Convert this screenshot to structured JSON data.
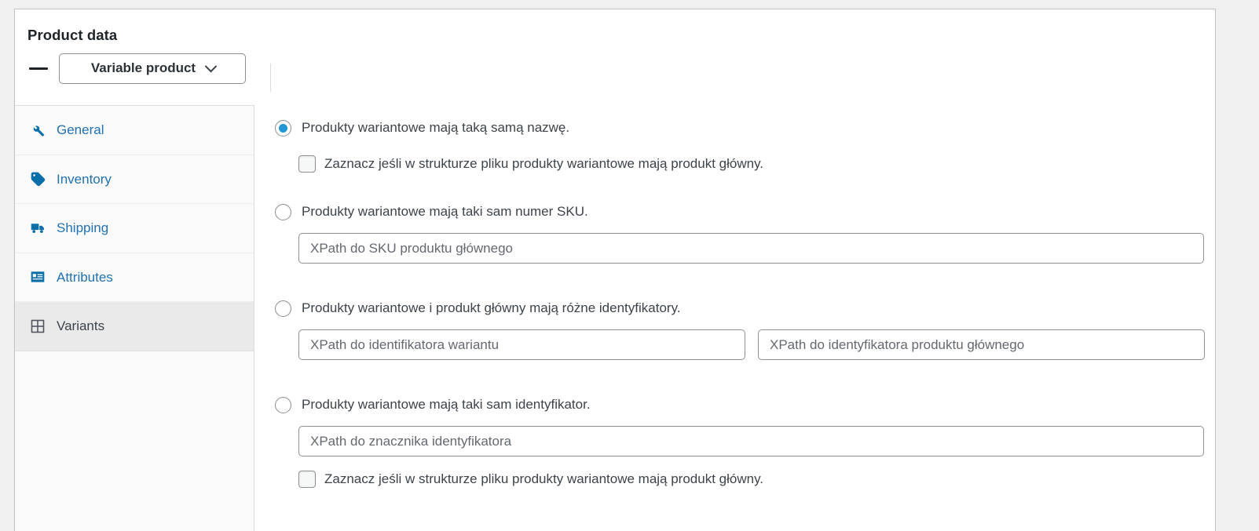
{
  "panel": {
    "title": "Product data",
    "product_type": {
      "selected": "Variable product",
      "chevron_icon": "chevron-down-icon",
      "toggle_icon": "minimize-dash-icon"
    }
  },
  "tabs": [
    {
      "id": "general",
      "label": "General",
      "icon": "wrench-icon",
      "active": false
    },
    {
      "id": "inventory",
      "label": "Inventory",
      "icon": "tag-icon",
      "active": false
    },
    {
      "id": "shipping",
      "label": "Shipping",
      "icon": "truck-icon",
      "active": false
    },
    {
      "id": "attributes",
      "label": "Attributes",
      "icon": "list-view-icon",
      "active": false
    },
    {
      "id": "variants",
      "label": "Variants",
      "icon": "grid-icon",
      "active": true
    }
  ],
  "variants_panel": {
    "groups": [
      {
        "id": "same-name",
        "radio_label": "Produkty wariantowe mają taką samą nazwę.",
        "radio_checked": true,
        "checkbox_label": "Zaznacz jeśli w strukturze pliku produkty wariantowe mają produkt główny.",
        "checkbox_checked": false
      },
      {
        "id": "same-sku",
        "radio_label": "Produkty wariantowe mają taki sam numer SKU.",
        "radio_checked": false,
        "input_placeholder": "XPath do SKU produktu głównego",
        "input_value": ""
      },
      {
        "id": "different-identifiers",
        "radio_label": "Produkty wariantowe i produkt główny mają różne identyfikatory.",
        "radio_checked": false,
        "input_left_placeholder": "XPath do identifikatora wariantu",
        "input_left_value": "",
        "input_right_placeholder": "XPath do identyfikatora produktu głównego",
        "input_right_value": ""
      },
      {
        "id": "same-identifier",
        "radio_label": "Produkty wariantowe mają taki sam identyfikator.",
        "radio_checked": false,
        "input_placeholder": "XPath do znacznika identyfikatora",
        "input_value": "",
        "checkbox_label": "Zaznacz jeśli w strukturze pliku produkty wariantowe mają produkt główny.",
        "checkbox_checked": false
      }
    ]
  },
  "colors": {
    "accent_blue": "#2271b1",
    "icon_blue": "#0a6ea8",
    "radio_fill": "#2196d3",
    "panel_bg": "#ffffff",
    "page_bg": "#f0f0f1",
    "active_tab_bg": "#eaeaea",
    "border": "#c3c4c7"
  }
}
